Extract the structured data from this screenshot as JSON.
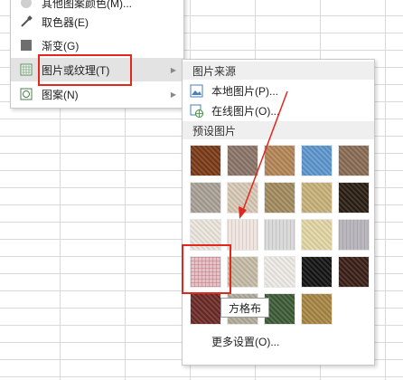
{
  "menu1": {
    "items": [
      {
        "label": "其他图案颜色(M)...",
        "icon": "color-circle-icon"
      },
      {
        "label": "取色器(E)",
        "icon": "eyedropper-icon"
      },
      {
        "label": "渐变(G)",
        "icon": "gradient-square-icon"
      },
      {
        "label": "图片或纹理(T)",
        "icon": "picture-texture-icon"
      },
      {
        "label": "图案(N)",
        "icon": "pattern-icon"
      }
    ]
  },
  "submenu": {
    "source_header": "图片来源",
    "local_label": "本地图片(P)...",
    "online_label": "在线图片(O)...",
    "preset_header": "预设图片",
    "more_label": "更多设置(O)...",
    "tooltip": "方格布"
  },
  "textures": [
    "#7a3a17",
    "#8b7568",
    "#b58657",
    "#5d97cf",
    "#8a6c55",
    "#a9a297",
    "#d8c9b6",
    "#a38c5e",
    "#c8b27a",
    "#2a1e12",
    "#ece6dd",
    "#f1e5e0",
    "#dadada",
    "#e3d7a6",
    "#bab7be",
    "#e4c2c6",
    "#c6bda8",
    "#efece7",
    "#141414",
    "#3a1e16",
    "#6c2a26",
    "#b2ac9a",
    "#3d5c36",
    "#a88643"
  ]
}
